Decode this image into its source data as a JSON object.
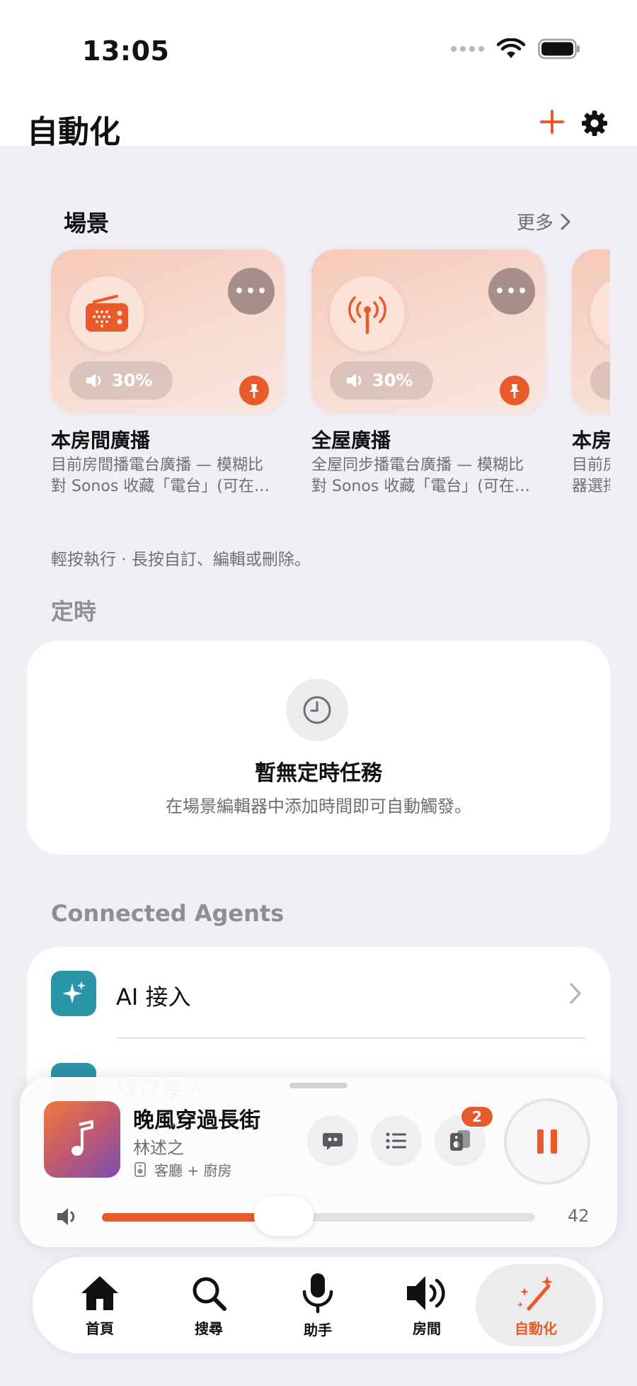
{
  "status_bar": {
    "time": "13:05"
  },
  "header": {
    "title": "自動化"
  },
  "colors": {
    "accent": "#e85a2a",
    "background": "#f0eff6",
    "agent_icon": "#2b95a8"
  },
  "scenes": {
    "title": "場景",
    "more": "更多",
    "items": [
      {
        "name": "本房間廣播",
        "desc_line1": "目前房間播電台廣播 — 模糊比",
        "desc_line2": "對 Sonos 收藏「電台」(可在…",
        "volume": "30%",
        "icon": "radio-icon",
        "pinned": true
      },
      {
        "name": "全屋廣播",
        "desc_line1": "全屋同步播電台廣播 — 模糊比",
        "desc_line2": "對 Sonos 收藏「電台」(可在…",
        "volume": "30%",
        "icon": "antenna-icon",
        "pinned": true
      },
      {
        "name": "本房",
        "desc_line1": "目前房",
        "desc_line2": "器選擇",
        "volume": "",
        "icon": "device-icon",
        "pinned": false
      }
    ],
    "hint": "輕按執行 · 長按自訂、編輯或刪除。"
  },
  "schedule": {
    "title": "定時",
    "empty_title": "暫無定時任務",
    "empty_subtitle": "在場景編輯器中添加時間即可自動觸發。"
  },
  "agents": {
    "title": "Connected Agents",
    "items": [
      {
        "label": "AI 接入",
        "icon": "sparkles-icon"
      },
      {
        "label": "提存接入",
        "icon": "link-icon"
      }
    ]
  },
  "player": {
    "title": "晚風穿過長街",
    "artist": "林述之",
    "rooms": "客廳 + 廚房",
    "speaker_badge": "2",
    "volume_value": "42",
    "volume_fraction": 0.42
  },
  "tabs": [
    {
      "label": "首頁",
      "icon": "home-icon"
    },
    {
      "label": "搜尋",
      "icon": "search-icon"
    },
    {
      "label": "助手",
      "icon": "mic-icon"
    },
    {
      "label": "房間",
      "icon": "speaker-icon"
    },
    {
      "label": "自動化",
      "icon": "magic-wand-icon",
      "active": true
    }
  ]
}
